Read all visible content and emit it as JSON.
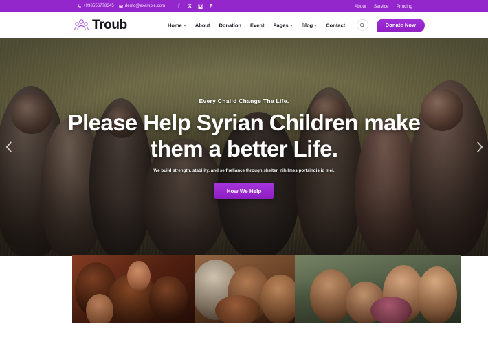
{
  "topbar": {
    "phone": "+998556778345",
    "email": "demo@example.com",
    "socials": [
      {
        "name": "facebook-icon",
        "glyph": "f"
      },
      {
        "name": "x-twitter-icon",
        "glyph": "X"
      },
      {
        "name": "instagram-icon",
        "glyph": "▣"
      },
      {
        "name": "pinterest-icon",
        "glyph": "P"
      }
    ],
    "links": [
      {
        "label": "About"
      },
      {
        "label": "Service"
      },
      {
        "label": "Princing"
      }
    ],
    "bg_color": "#9427cc"
  },
  "navbar": {
    "brand": "Troub",
    "menu": [
      {
        "label": "Home",
        "has_dropdown": true
      },
      {
        "label": "About",
        "has_dropdown": false
      },
      {
        "label": "Donation",
        "has_dropdown": false
      },
      {
        "label": "Event",
        "has_dropdown": false
      },
      {
        "label": "Pages",
        "has_dropdown": true
      },
      {
        "label": "Blog",
        "has_dropdown": true
      },
      {
        "label": "Contact",
        "has_dropdown": false
      }
    ],
    "search_label": "Search",
    "donate_label": "Donate Now",
    "accent_color": "#9427cc"
  },
  "hero": {
    "eyebrow": "Every Chaild Change The Life.",
    "title": "Please Help Syrian Children make them a better Life.",
    "subtitle": "We build strength, stability, and self reliance through shelter, nihilmes portsindis id mei.",
    "cta_label": "How We Help",
    "prev_label": "Previous slide",
    "next_label": "Next slide"
  },
  "gallery": {
    "items": [
      {
        "alt": "Children reaching hands toward camera"
      },
      {
        "alt": "Volunteer with group of children"
      },
      {
        "alt": "Four smiling children hugging outdoors"
      }
    ]
  }
}
